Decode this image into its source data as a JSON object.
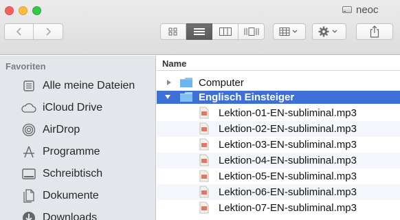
{
  "window": {
    "title": "neoc"
  },
  "toolbar": {
    "back_icon": "chevron-left-icon",
    "forward_icon": "chevron-right-icon",
    "view_modes": [
      "icon-view",
      "list-view",
      "column-view",
      "coverflow-view"
    ],
    "active_view": "list-view",
    "arrange_icon": "arrange-grid-icon",
    "action_icon": "gear-icon",
    "share_icon": "share-icon"
  },
  "sidebar": {
    "heading": "Favoriten",
    "items": [
      {
        "label": "Alle meine Dateien",
        "icon": "all-files-icon"
      },
      {
        "label": "iCloud Drive",
        "icon": "cloud-icon"
      },
      {
        "label": "AirDrop",
        "icon": "airdrop-icon"
      },
      {
        "label": "Programme",
        "icon": "applications-icon"
      },
      {
        "label": "Schreibtisch",
        "icon": "desktop-icon"
      },
      {
        "label": "Dokumente",
        "icon": "documents-icon"
      },
      {
        "label": "Downloads",
        "icon": "downloads-icon"
      }
    ]
  },
  "filelist": {
    "column_name": "Name",
    "rows": [
      {
        "label": "Computer",
        "type": "folder",
        "expanded": false
      },
      {
        "label": "Englisch Einsteiger",
        "type": "folder",
        "expanded": true,
        "selected": true
      },
      {
        "label": "Lektion-01-EN-subliminal.mp3",
        "type": "file"
      },
      {
        "label": "Lektion-02-EN-subliminal.mp3",
        "type": "file"
      },
      {
        "label": "Lektion-03-EN-subliminal.mp3",
        "type": "file"
      },
      {
        "label": "Lektion-04-EN-subliminal.mp3",
        "type": "file"
      },
      {
        "label": "Lektion-05-EN-subliminal.mp3",
        "type": "file"
      },
      {
        "label": "Lektion-06-EN-subliminal.mp3",
        "type": "file"
      },
      {
        "label": "Lektion-07-EN-subliminal.mp3",
        "type": "file"
      }
    ]
  },
  "colors": {
    "selection": "#3d6fd6",
    "sidebar_bg": "#e3e7ec",
    "folder": "#6cb4f0"
  }
}
